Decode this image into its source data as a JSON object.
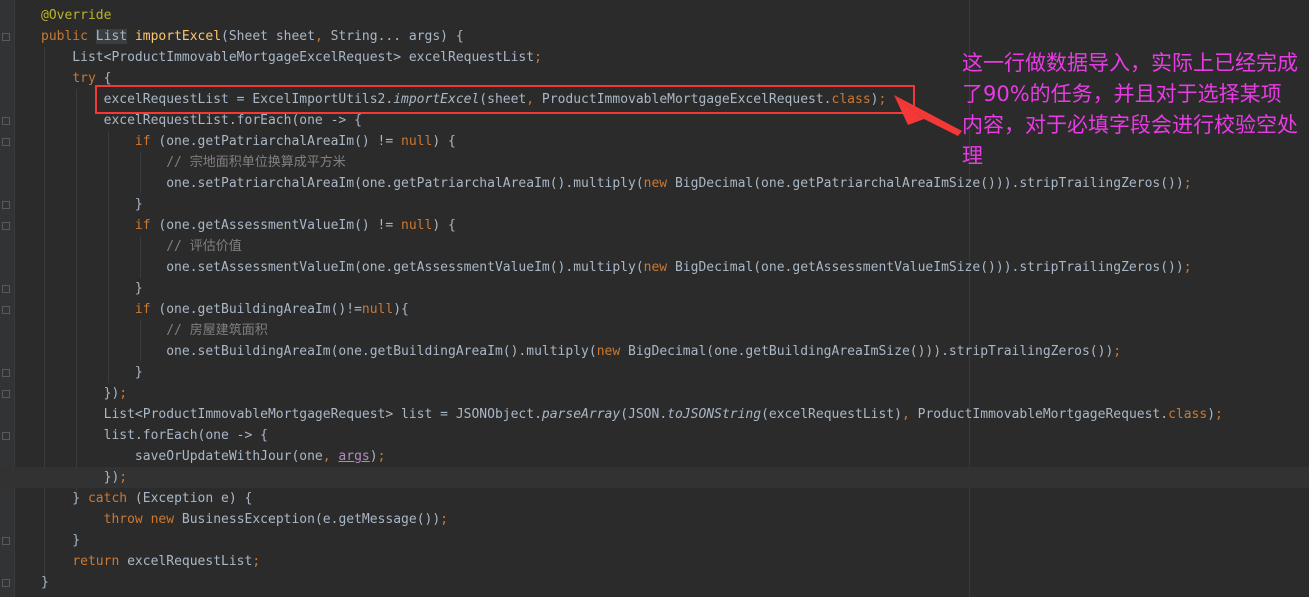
{
  "editor": {
    "lines": [
      [
        {
          "t": "@Override",
          "c": "ann"
        }
      ],
      [
        {
          "t": "public ",
          "c": "kw"
        },
        {
          "t": "List",
          "c": "hl"
        },
        {
          "t": " "
        },
        {
          "t": "importExcel",
          "c": "fn"
        },
        {
          "t": "(Sheet sheet"
        },
        {
          "t": ", ",
          "c": "kw"
        },
        {
          "t": "String... args) {"
        }
      ],
      [
        {
          "t": "    List<ProductImmovableMortgageExcelRequest> excelRequestList"
        },
        {
          "t": ";",
          "c": "kw"
        }
      ],
      [
        {
          "t": "    "
        },
        {
          "t": "try",
          "c": "kw"
        },
        {
          "t": " {"
        }
      ],
      [
        {
          "t": "        excelRequestList = ExcelImportUtils2."
        },
        {
          "t": "importExcel",
          "c": "it"
        },
        {
          "t": "(sheet"
        },
        {
          "t": ", ",
          "c": "kw"
        },
        {
          "t": "ProductImmovableMortgageExcelRequest."
        },
        {
          "t": "class",
          "c": "kw"
        },
        {
          "t": ")"
        },
        {
          "t": ";",
          "c": "kw"
        }
      ],
      [
        {
          "t": "        excelRequestList.forEach(one -> {"
        }
      ],
      [
        {
          "t": "            "
        },
        {
          "t": "if",
          "c": "kw"
        },
        {
          "t": " (one.getPatriarchalAreaIm() != "
        },
        {
          "t": "null",
          "c": "kw"
        },
        {
          "t": ") {"
        }
      ],
      [
        {
          "t": "                "
        },
        {
          "t": "// 宗地面积单位换算成平方米",
          "c": "cm"
        }
      ],
      [
        {
          "t": "                one.setPatriarchalAreaIm(one.getPatriarchalAreaIm().multiply("
        },
        {
          "t": "new ",
          "c": "kw"
        },
        {
          "t": "BigDecimal(one.getPatriarchalAreaImSize())).stripTrailingZeros())"
        },
        {
          "t": ";",
          "c": "kw"
        }
      ],
      [
        {
          "t": "            }"
        }
      ],
      [
        {
          "t": "            "
        },
        {
          "t": "if",
          "c": "kw"
        },
        {
          "t": " (one.getAssessmentValueIm() != "
        },
        {
          "t": "null",
          "c": "kw"
        },
        {
          "t": ") {"
        }
      ],
      [
        {
          "t": "                "
        },
        {
          "t": "// 评估价值",
          "c": "cm"
        }
      ],
      [
        {
          "t": "                one.setAssessmentValueIm(one.getAssessmentValueIm().multiply("
        },
        {
          "t": "new ",
          "c": "kw"
        },
        {
          "t": "BigDecimal(one.getAssessmentValueImSize())).stripTrailingZeros())"
        },
        {
          "t": ";",
          "c": "kw"
        }
      ],
      [
        {
          "t": "            }"
        }
      ],
      [
        {
          "t": "            "
        },
        {
          "t": "if",
          "c": "kw"
        },
        {
          "t": " (one.getBuildingAreaIm()!="
        },
        {
          "t": "null",
          "c": "kw"
        },
        {
          "t": "){"
        }
      ],
      [
        {
          "t": "                "
        },
        {
          "t": "// 房屋建筑面积",
          "c": "cm"
        }
      ],
      [
        {
          "t": "                one.setBuildingAreaIm(one.getBuildingAreaIm().multiply("
        },
        {
          "t": "new ",
          "c": "kw"
        },
        {
          "t": "BigDecimal(one.getBuildingAreaImSize())).stripTrailingZeros())"
        },
        {
          "t": ";",
          "c": "kw"
        }
      ],
      [
        {
          "t": "            }"
        }
      ],
      [
        {
          "t": "        })"
        },
        {
          "t": ";",
          "c": "kw"
        }
      ],
      [
        {
          "t": "        List<ProductImmovableMortgageRequest> list = JSONObject."
        },
        {
          "t": "parseArray",
          "c": "it"
        },
        {
          "t": "(JSON."
        },
        {
          "t": "toJSONString",
          "c": "it"
        },
        {
          "t": "(excelRequestList)"
        },
        {
          "t": ", ",
          "c": "kw"
        },
        {
          "t": "ProductImmovableMortgageRequest."
        },
        {
          "t": "class",
          "c": "kw"
        },
        {
          "t": ")"
        },
        {
          "t": ";",
          "c": "kw"
        }
      ],
      [
        {
          "t": "        list.forEach(one -> {"
        }
      ],
      [
        {
          "t": "            saveOrUpdateWithJour(one"
        },
        {
          "t": ", ",
          "c": "kw"
        },
        {
          "t": "args",
          "c": "pl"
        },
        {
          "t": ")"
        },
        {
          "t": ";",
          "c": "kw"
        }
      ],
      [
        {
          "t": "        })"
        },
        {
          "t": ";",
          "c": "kw"
        }
      ],
      [
        {
          "t": "    } "
        },
        {
          "t": "catch",
          "c": "kw"
        },
        {
          "t": " (Exception e) {"
        }
      ],
      [
        {
          "t": "        "
        },
        {
          "t": "throw new ",
          "c": "kw"
        },
        {
          "t": "BusinessException(e.getMessage())"
        },
        {
          "t": ";",
          "c": "kw"
        }
      ],
      [
        {
          "t": "    }"
        }
      ],
      [
        {
          "t": "    "
        },
        {
          "t": "return ",
          "c": "kw"
        },
        {
          "t": "excelRequestList"
        },
        {
          "t": ";",
          "c": "kw"
        }
      ],
      [
        {
          "t": "}"
        }
      ]
    ],
    "current_line": 22
  },
  "annotation": {
    "text": "这一行做数据导入，实际上已经完成了90%的任务，并且对于选择某项内容，对于必填字段会进行校验空处理",
    "color": "#e93be4",
    "highlight_color": "#f43838"
  }
}
